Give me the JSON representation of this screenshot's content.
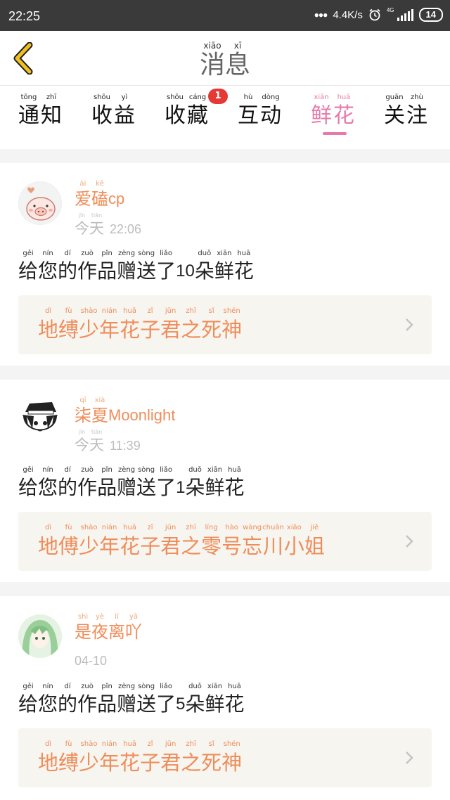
{
  "status_bar": {
    "time": "22:25",
    "speed": "4.4K/s",
    "network": "4G",
    "battery": "14"
  },
  "header": {
    "title_pinyin": [
      "xiāo",
      "xī"
    ],
    "title_chars": [
      "消",
      "息"
    ]
  },
  "tabs": [
    {
      "label": "通知",
      "pinyin": [
        "tōng",
        "zhī"
      ],
      "chars": [
        "通",
        "知"
      ]
    },
    {
      "label": "收益",
      "pinyin": [
        "shōu",
        "yì"
      ],
      "chars": [
        "收",
        "益"
      ]
    },
    {
      "label": "收藏",
      "pinyin": [
        "shōu",
        "cáng"
      ],
      "chars": [
        "收",
        "藏"
      ],
      "badge": "1"
    },
    {
      "label": "互动",
      "pinyin": [
        "hù",
        "dòng"
      ],
      "chars": [
        "互",
        "动"
      ]
    },
    {
      "label": "鲜花",
      "pinyin": [
        "xiān",
        "huā"
      ],
      "chars": [
        "鲜",
        "花"
      ],
      "active": true
    },
    {
      "label": "关注",
      "pinyin": [
        "guān",
        "zhù"
      ],
      "chars": [
        "关",
        "注"
      ]
    }
  ],
  "notifications": [
    {
      "user_chars": [
        {
          "h": "爱",
          "p": "ài"
        },
        {
          "h": "磕",
          "p": "kē"
        }
      ],
      "user_suffix": "cp",
      "date_chars": [
        {
          "h": "今",
          "p": "jīn"
        },
        {
          "h": "天",
          "p": "tiān"
        }
      ],
      "time": "22:06",
      "message_pre": [
        {
          "h": "给",
          "p": "gěi"
        },
        {
          "h": "您",
          "p": "nín"
        },
        {
          "h": "的",
          "p": "dí"
        },
        {
          "h": "作",
          "p": "zuò"
        },
        {
          "h": "品",
          "p": "pǐn"
        },
        {
          "h": "赠",
          "p": "zèng"
        },
        {
          "h": "送",
          "p": "sòng"
        },
        {
          "h": "了",
          "p": "liǎo"
        }
      ],
      "count": "10",
      "message_post": [
        {
          "h": "朵",
          "p": "duǒ"
        },
        {
          "h": "鲜",
          "p": "xiān"
        },
        {
          "h": "花",
          "p": "huā"
        }
      ],
      "work_chars": [
        {
          "h": "地",
          "p": "dì"
        },
        {
          "h": "缚",
          "p": "fù"
        },
        {
          "h": "少",
          "p": "shào"
        },
        {
          "h": "年",
          "p": "nián"
        },
        {
          "h": "花",
          "p": "huā"
        },
        {
          "h": "子",
          "p": "zǐ"
        },
        {
          "h": "君",
          "p": "jūn"
        },
        {
          "h": "之",
          "p": "zhī"
        },
        {
          "h": "死",
          "p": "sǐ"
        },
        {
          "h": "神",
          "p": "shén"
        }
      ]
    },
    {
      "user_chars": [
        {
          "h": "柒",
          "p": "qī"
        },
        {
          "h": "夏",
          "p": "xià"
        }
      ],
      "user_suffix": "Moonlight",
      "date_chars": [
        {
          "h": "今",
          "p": "jīn"
        },
        {
          "h": "天",
          "p": "tiān"
        }
      ],
      "time": "11:39",
      "message_pre": [
        {
          "h": "给",
          "p": "gěi"
        },
        {
          "h": "您",
          "p": "nín"
        },
        {
          "h": "的",
          "p": "dí"
        },
        {
          "h": "作",
          "p": "zuò"
        },
        {
          "h": "品",
          "p": "pǐn"
        },
        {
          "h": "赠",
          "p": "zèng"
        },
        {
          "h": "送",
          "p": "sòng"
        },
        {
          "h": "了",
          "p": "liǎo"
        }
      ],
      "count": "1",
      "message_post": [
        {
          "h": "朵",
          "p": "duǒ"
        },
        {
          "h": "鲜",
          "p": "xiān"
        },
        {
          "h": "花",
          "p": "huā"
        }
      ],
      "work_chars": [
        {
          "h": "地",
          "p": "dì"
        },
        {
          "h": "傅",
          "p": "fù"
        },
        {
          "h": "少",
          "p": "shào"
        },
        {
          "h": "年",
          "p": "nián"
        },
        {
          "h": "花",
          "p": "huā"
        },
        {
          "h": "子",
          "p": "zǐ"
        },
        {
          "h": "君",
          "p": "jūn"
        },
        {
          "h": "之",
          "p": "zhī"
        },
        {
          "h": "零",
          "p": "líng"
        },
        {
          "h": "号",
          "p": "hào"
        },
        {
          "h": "忘",
          "p": "wàng"
        },
        {
          "h": "川",
          "p": "chuān"
        },
        {
          "h": "小",
          "p": "xiǎo"
        },
        {
          "h": "姐",
          "p": "jiě"
        }
      ]
    },
    {
      "user_chars": [
        {
          "h": "是",
          "p": "shì"
        },
        {
          "h": "夜",
          "p": "yè"
        },
        {
          "h": "离",
          "p": "lí"
        },
        {
          "h": "吖",
          "p": "yā"
        }
      ],
      "user_suffix": "",
      "date_chars": [],
      "time": "04-10",
      "message_pre": [
        {
          "h": "给",
          "p": "gěi"
        },
        {
          "h": "您",
          "p": "nín"
        },
        {
          "h": "的",
          "p": "dí"
        },
        {
          "h": "作",
          "p": "zuò"
        },
        {
          "h": "品",
          "p": "pǐn"
        },
        {
          "h": "赠",
          "p": "zèng"
        },
        {
          "h": "送",
          "p": "sòng"
        },
        {
          "h": "了",
          "p": "liǎo"
        }
      ],
      "count": "5",
      "message_post": [
        {
          "h": "朵",
          "p": "duǒ"
        },
        {
          "h": "鲜",
          "p": "xiān"
        },
        {
          "h": "花",
          "p": "huā"
        }
      ],
      "work_chars": [
        {
          "h": "地",
          "p": "dì"
        },
        {
          "h": "缚",
          "p": "fù"
        },
        {
          "h": "少",
          "p": "shào"
        },
        {
          "h": "年",
          "p": "nián"
        },
        {
          "h": "花",
          "p": "huā"
        },
        {
          "h": "子",
          "p": "zǐ"
        },
        {
          "h": "君",
          "p": "jūn"
        },
        {
          "h": "之",
          "p": "zhī"
        },
        {
          "h": "死",
          "p": "sǐ"
        },
        {
          "h": "神",
          "p": "shén"
        }
      ]
    }
  ],
  "colors": {
    "accent_pink": "#e77aa9",
    "accent_orange": "#ef8d5a",
    "badge_red": "#e53935",
    "back_yellow": "#f2c01e"
  },
  "icons": {
    "back": "chevron-left-icon",
    "alarm": "alarm-clock-icon",
    "work_link": "chevron-right-icon"
  }
}
